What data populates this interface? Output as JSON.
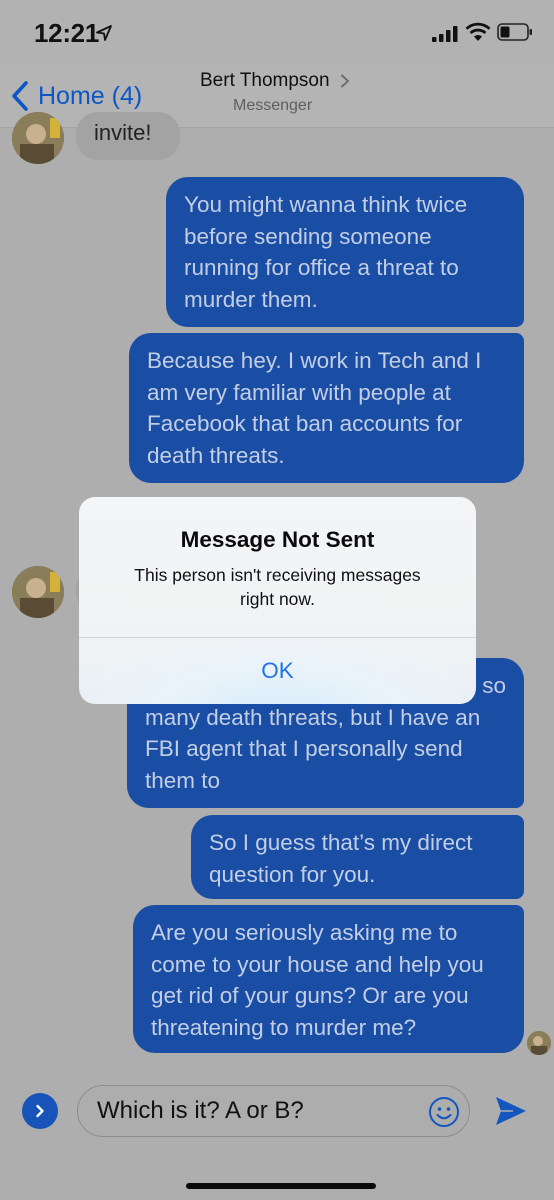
{
  "status_bar": {
    "time": "12:21"
  },
  "nav": {
    "back_label": "Home (4)",
    "contact_name": "Bert Thompson",
    "subtitle": "Messenger"
  },
  "messages": {
    "incoming_top": "invite!",
    "outgoing": [
      "You might wanna think twice before sending someone running for office a threat to murder them.",
      "Because hey. I work in Tech and I am very familiar with people at Facebook that ban accounts for death threats.",
      "so many death threats, but I have an FBI agent that I personally send them to",
      "So I guess that’s my direct question for you.",
      "Are you seriously asking me to come to your house and help you get rid of your guns? Or are you threatening to murder me?"
    ],
    "outgoing_third_line1": "so",
    "outgoing_third_rest": "many death threats, but I have an FBI agent that I personally send them to"
  },
  "composer": {
    "input_value": "Which is it? A or B?"
  },
  "alert": {
    "title": "Message Not Sent",
    "message": "This person isn't receiving messages right now.",
    "ok_label": "OK"
  },
  "colors": {
    "accent": "#1f74e6",
    "bubble_outgoing": "#1a4ea5"
  }
}
